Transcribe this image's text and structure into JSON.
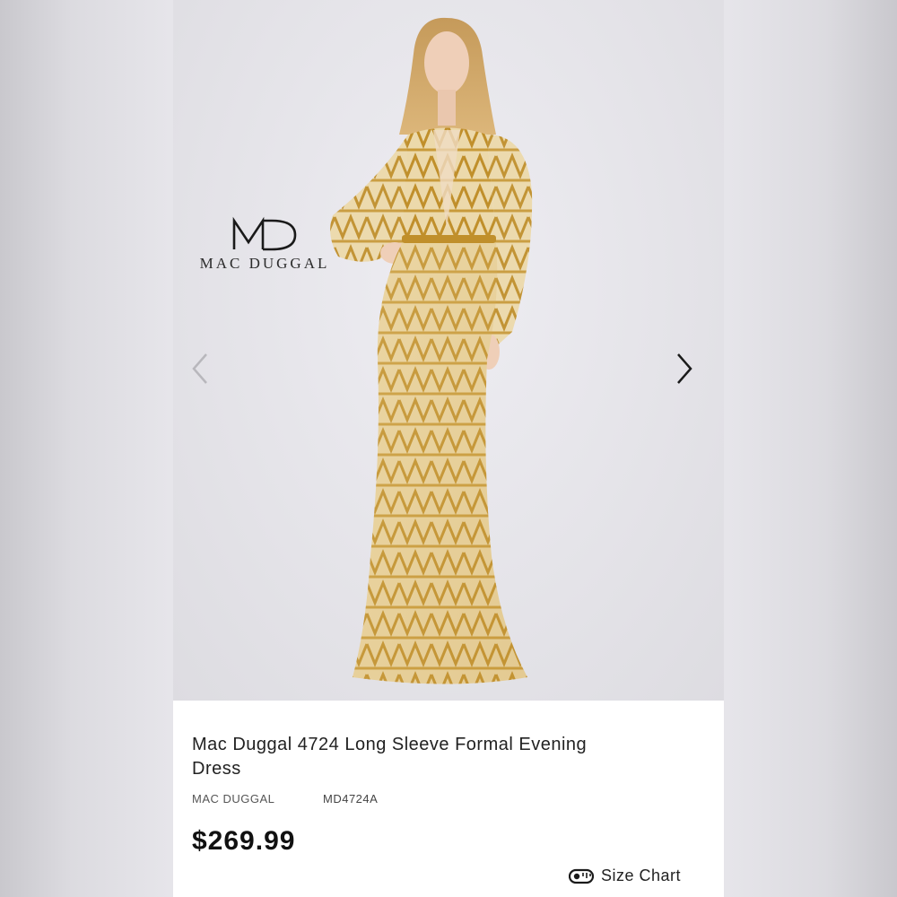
{
  "brand_logo": {
    "monogram": "MD",
    "wordmark": "MAC DUGGAL"
  },
  "gallery": {
    "prev_icon": "chevron-left-icon",
    "next_icon": "chevron-right-icon",
    "photo": "model in gold beaded long sleeve gown"
  },
  "product": {
    "title": "Mac Duggal 4724 Long Sleeve Formal Evening Dress",
    "brand": "MAC DUGGAL",
    "sku": "MD4724A",
    "price": "$269.99"
  },
  "size_chart": {
    "label": "Size Chart",
    "icon": "tape-measure-icon"
  },
  "colors": {
    "gold": "#c9a24a",
    "accent_dark": "#111111",
    "background": "#e6e5ea"
  }
}
